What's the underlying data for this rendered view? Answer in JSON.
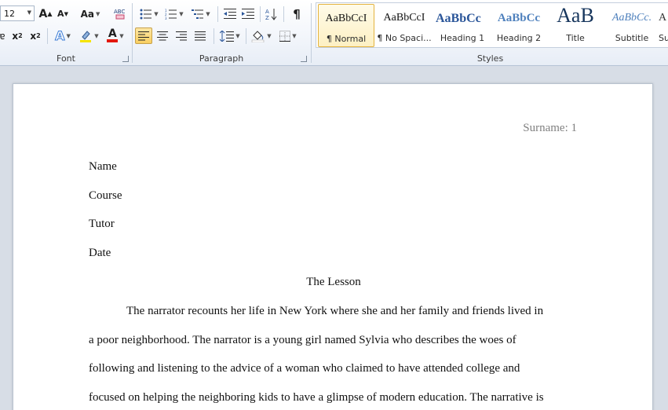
{
  "ribbon": {
    "font_group": {
      "label": "Font",
      "font_size": "12",
      "grow_font": "A",
      "shrink_font": "A",
      "change_case": "Aa",
      "clear_format": "ABC",
      "subscript": "x",
      "subscript_mark": "2",
      "superscript": "x",
      "superscript_mark": "2",
      "text_effects": "A",
      "font_color": "A",
      "highlight_color": "#f5e400",
      "font_color_value": "#e3180d"
    },
    "paragraph_group": {
      "label": "Paragraph"
    },
    "styles_group": {
      "label": "Styles",
      "items": [
        {
          "sample": "AaBbCcI",
          "name": "¶ Normal"
        },
        {
          "sample": "AaBbCcI",
          "name": "¶ No Spaci..."
        },
        {
          "sample": "AaBbCc",
          "name": "Heading 1"
        },
        {
          "sample": "AaBbCc",
          "name": "Heading 2"
        },
        {
          "sample": "AaB",
          "name": "Title"
        },
        {
          "sample": "AaBbCc.",
          "name": "Subtitle"
        },
        {
          "sample": "A",
          "name": "Su"
        }
      ]
    }
  },
  "document": {
    "header": "Surname: 1",
    "lines": [
      "Name",
      "Course",
      "Tutor",
      "Date"
    ],
    "title": "The Lesson",
    "paragraph": [
      "The narrator recounts her life in New York where she and her family and friends lived in",
      "a poor neighborhood. The narrator is a young girl named Sylvia who describes the woes of",
      "following and listening to the advice of a woman who claimed to have attended college and",
      "focused on helping the neighboring kids to have a glimpse of modern education. The narrative is"
    ]
  }
}
